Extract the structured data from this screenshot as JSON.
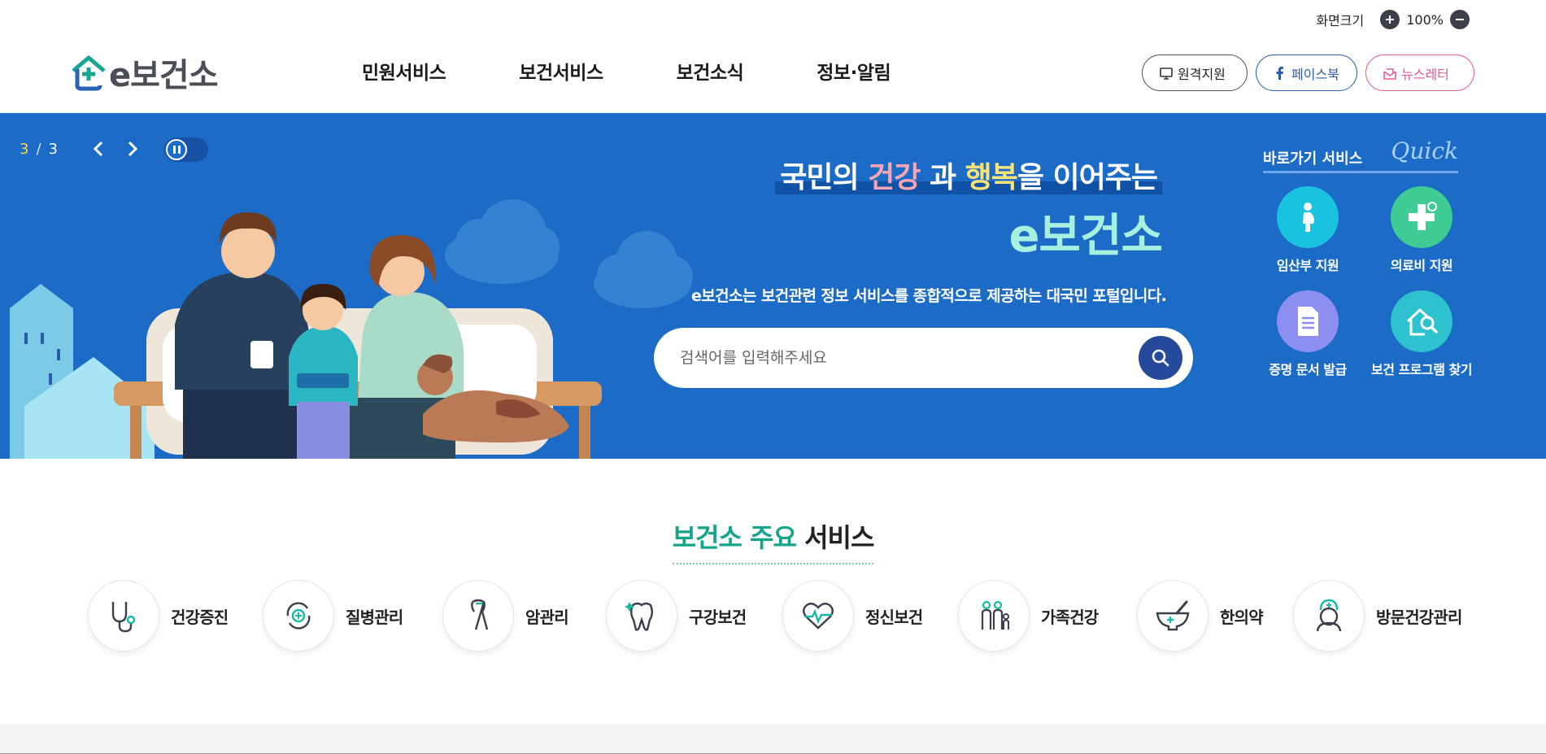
{
  "utility": {
    "font_size_label": "화면크기",
    "zoom_value": "100%",
    "zoom_in_icon": "plus-icon",
    "zoom_out_icon": "minus-icon"
  },
  "header": {
    "logo_text": "e보건소",
    "nav": [
      "민원서비스",
      "보건서비스",
      "보건소식",
      "정보·알림"
    ],
    "buttons": {
      "remote": "원격지원",
      "facebook": "페이스북",
      "newsletter": "뉴스레터"
    }
  },
  "banner": {
    "slide_current": "3",
    "slide_separator": "/",
    "slide_total": "3",
    "headline_part1": "국민의",
    "headline_health": "건강",
    "headline_part2": "과",
    "headline_happy": "행복",
    "headline_part3": "을 이어주는",
    "headline_brand": "e보건소",
    "tagline": "e보건소는 보건관련 정보 서비스를 종합적으로 제공하는 대국민 포털입니다.",
    "search_placeholder": "검색어를 입력해주세요"
  },
  "quick": {
    "title": "바로가기 서비스",
    "title_en": "Quick",
    "items": [
      {
        "label": "임산부 지원",
        "icon": "pregnant-woman-icon",
        "color": "#19c3e0"
      },
      {
        "label": "의료비 지원",
        "icon": "medical-cross-icon",
        "color": "#3ecb94"
      },
      {
        "label": "증명 문서 발급",
        "icon": "document-icon",
        "color": "#8d8ff0"
      },
      {
        "label": "보건 프로그램 찾기",
        "icon": "home-search-icon",
        "color": "#2ec2cf"
      }
    ]
  },
  "services": {
    "title_accent": "보건소 주요",
    "title_rest": "서비스",
    "items": [
      {
        "label": "건강증진",
        "icon": "stethoscope-icon"
      },
      {
        "label": "질병관리",
        "icon": "disease-cycle-icon"
      },
      {
        "label": "암관리",
        "icon": "cancer-ribbon-icon"
      },
      {
        "label": "구강보건",
        "icon": "tooth-icon"
      },
      {
        "label": "정신보건",
        "icon": "heart-pulse-icon"
      },
      {
        "label": "가족건강",
        "icon": "family-icon"
      },
      {
        "label": "한의약",
        "icon": "mortar-icon"
      },
      {
        "label": "방문건강관리",
        "icon": "nurse-icon"
      }
    ]
  },
  "colors": {
    "banner_bg": "#1c6cc7",
    "accent_green": "#13a589",
    "icon_dark": "#3a3f4b",
    "icon_teal": "#17b9a4"
  }
}
